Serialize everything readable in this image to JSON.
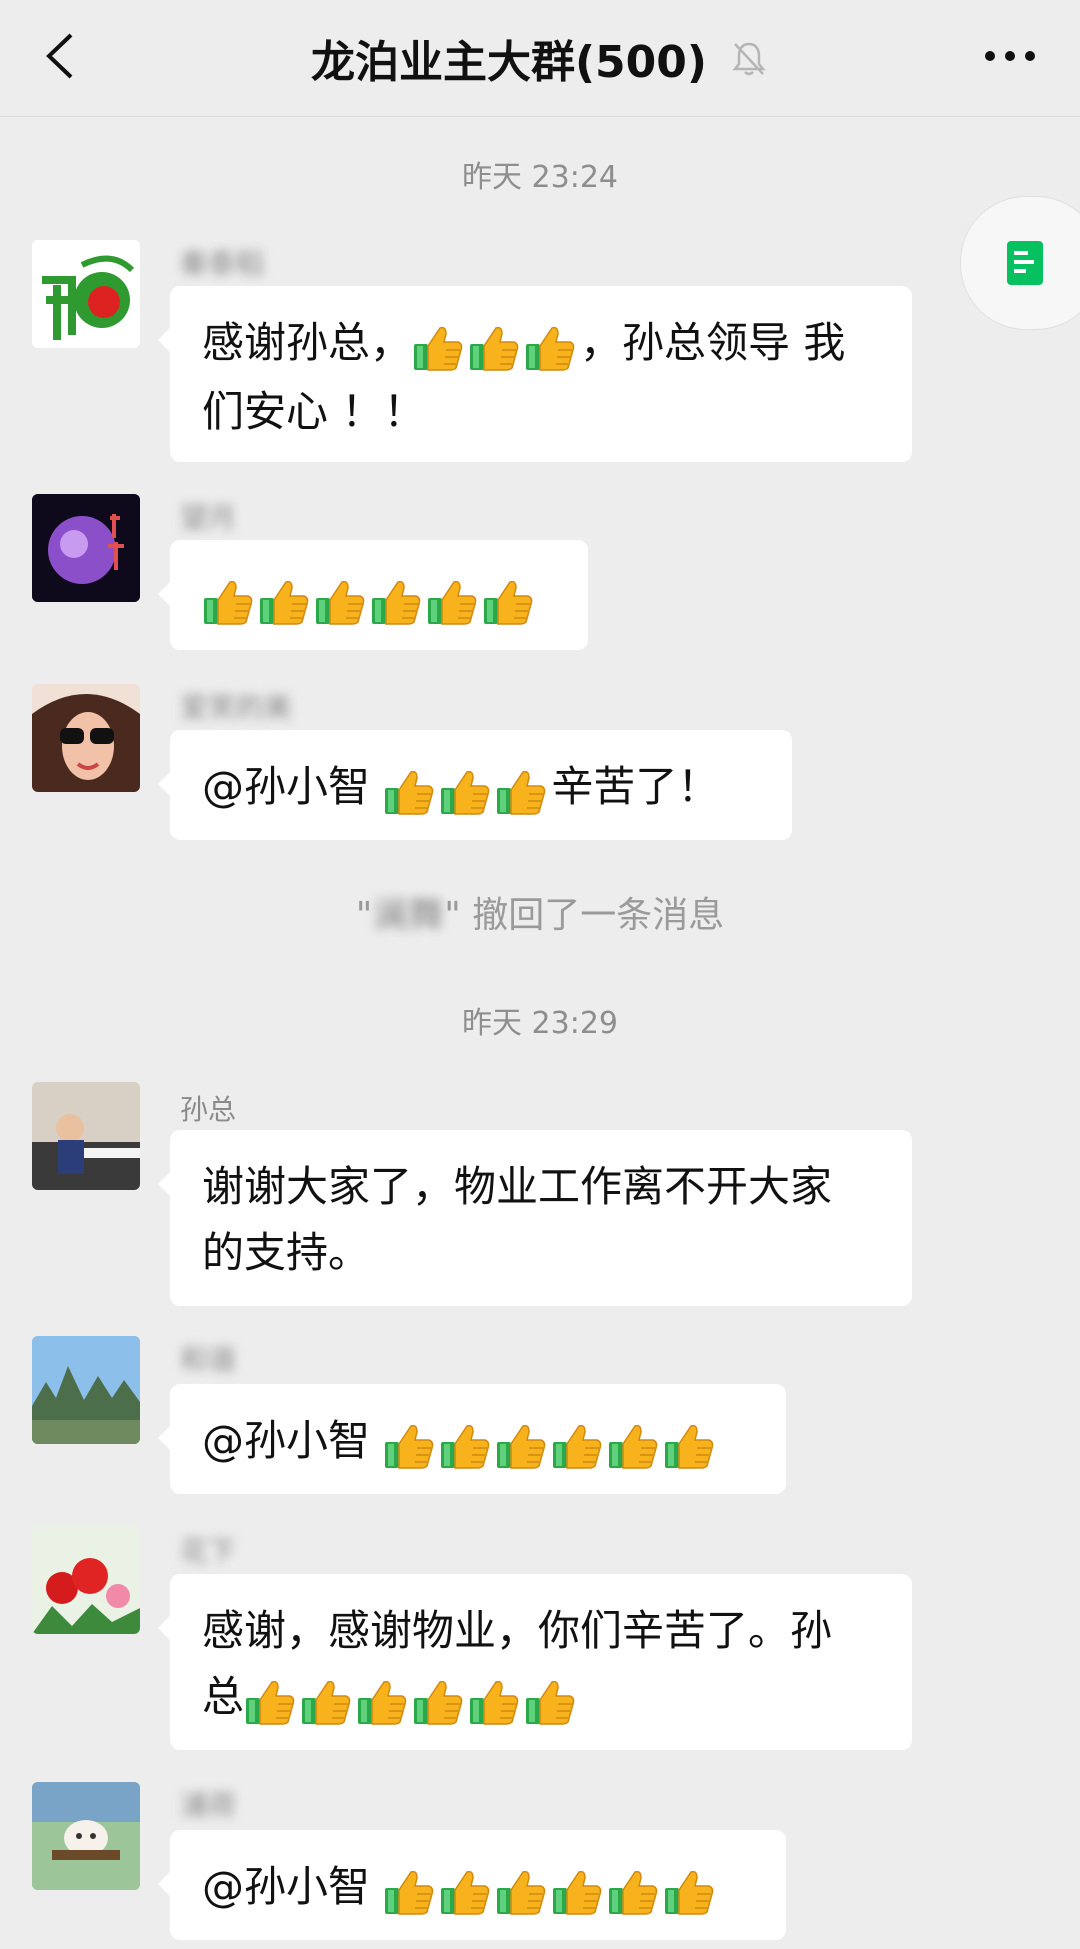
{
  "header": {
    "title": "龙泊业主大群(500)",
    "muted_icon": "bell-off-icon",
    "back_icon": "chevron-left-icon",
    "more_icon": "more-dots-icon"
  },
  "timestamps": [
    "昨天 23:24",
    "昨天 23:29"
  ],
  "messages": [
    {
      "sender": "秦泰稻",
      "text": "感谢孙总，",
      "text_after": "，孙总领导 我",
      "text_line2": "们安心 ！！",
      "thumbs": 3
    },
    {
      "sender": "望月",
      "text": "",
      "thumbs": 6
    },
    {
      "sender": "爱笑的美",
      "text": "@孙小智 ",
      "text_after": "辛苦了！",
      "thumbs": 3
    },
    {
      "sender": "孙总",
      "text": "谢谢大家了，物业工作离不开大家",
      "text_line2": "的支持。",
      "thumbs": 0
    },
    {
      "sender": "和谐",
      "text": "@孙小智 ",
      "thumbs": 6
    },
    {
      "sender": "花下",
      "text": "感谢，感谢物业，你们辛苦了。孙",
      "text_line2": "总",
      "thumbs": 6
    },
    {
      "sender": "浦荷",
      "text": "@孙小智 ",
      "thumbs": 6
    }
  ],
  "recall": {
    "name": "澜舞",
    "suffix": "\" 撤回了一条消息",
    "prefix": "\""
  },
  "colors": {
    "background": "#ededed",
    "bubble": "#ffffff",
    "accent_green": "#07c160"
  }
}
